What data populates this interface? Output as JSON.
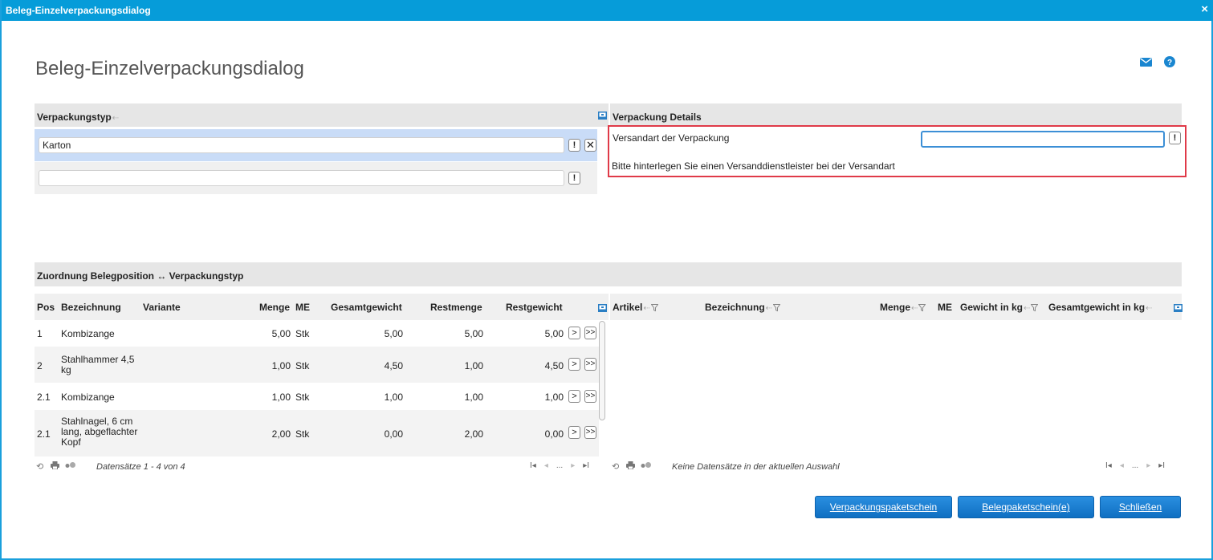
{
  "window": {
    "title": "Beleg-Einzelverpackungsdialog",
    "close_glyph": "×"
  },
  "page": {
    "title": "Beleg-Einzelverpackungsdialog"
  },
  "icons": {
    "mail": "mail-icon",
    "help": "help-icon",
    "colors": {
      "accent": "#069cd9",
      "button": "#1a7fd4",
      "highlight_border": "#e03a48",
      "selected_row": "#c9dcf7"
    }
  },
  "packaging_type": {
    "header": "Verpackungstyp",
    "rows": [
      {
        "value": "Karton"
      },
      {
        "value": ""
      }
    ],
    "warn_glyph": "!",
    "remove_glyph": "✕"
  },
  "details": {
    "header": "Verpackung Details",
    "shipping_label": "Versandart der Verpackung",
    "shipping_value": "",
    "message": "Bitte hinterlegen Sie einen Versanddienstleister bei der Versandart"
  },
  "assignment": {
    "header": "Zuordnung Belegposition ↔ Verpackungstyp"
  },
  "left_grid": {
    "columns": {
      "pos": "Pos",
      "bez": "Bezeichnung",
      "var": "Variante",
      "menge": "Menge",
      "me": "ME",
      "gesamt": "Gesamtgewicht",
      "rest": "Restmenge",
      "restgew": "Restgewicht"
    },
    "rows": [
      {
        "pos": "1",
        "bez": "Kombizange",
        "var": "",
        "menge": "5,00",
        "me": "Stk",
        "gesamt": "5,00",
        "rest": "5,00",
        "restgew": "5,00"
      },
      {
        "pos": "2",
        "bez": "Stahlhammer 4,5 kg",
        "var": "",
        "menge": "1,00",
        "me": "Stk",
        "gesamt": "4,50",
        "rest": "1,00",
        "restgew": "4,50"
      },
      {
        "pos": "2.1",
        "bez": "Kombizange",
        "var": "",
        "menge": "1,00",
        "me": "Stk",
        "gesamt": "1,00",
        "rest": "1,00",
        "restgew": "1,00"
      },
      {
        "pos": "2.1",
        "bez": "Stahlnagel, 6 cm lang, abgeflachter Kopf",
        "var": "",
        "menge": "2,00",
        "me": "Stk",
        "gesamt": "0,00",
        "rest": "2,00",
        "restgew": "0,00"
      }
    ],
    "btn_one": ">",
    "btn_all": ">>",
    "footer": "Datensätze 1 - 4 von 4",
    "pager": {
      "first": "I◂",
      "prev": "◂",
      "dots": "...",
      "next": "▸",
      "last": "▸I"
    }
  },
  "right_grid": {
    "columns": {
      "artikel": "Artikel",
      "bez": "Bezeichnung",
      "menge": "Menge",
      "me": "ME",
      "gewicht": "Gewicht in kg",
      "gesamt": "Gesamtgewicht in kg"
    },
    "footer": "Keine Datensätze in der aktuellen Auswahl",
    "pager": {
      "first": "I◂",
      "prev": "◂",
      "dots": "...",
      "next": "▸",
      "last": "▸I"
    }
  },
  "buttons": {
    "verpackungsschein": "Verpackungspaketschein",
    "belegschein": "Belegpaketschein(e)",
    "schliessen": "Schließen"
  }
}
